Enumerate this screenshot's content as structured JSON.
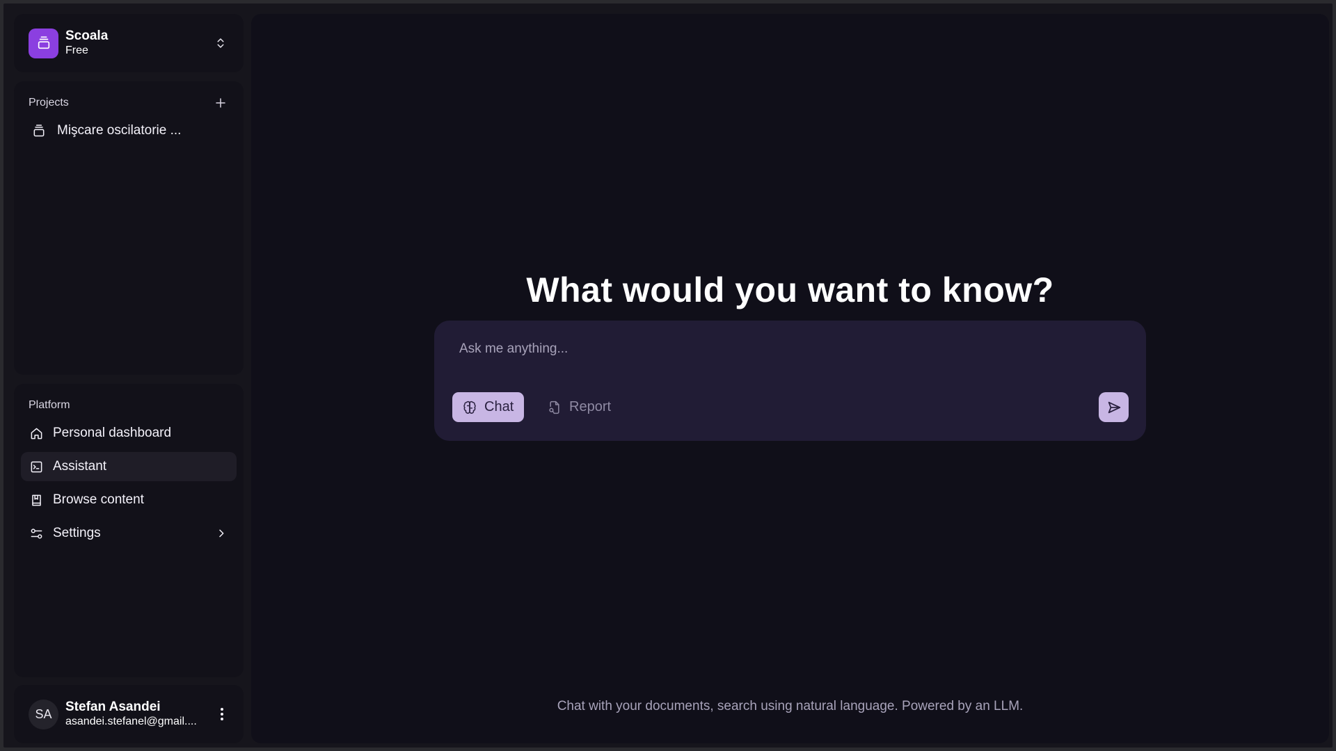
{
  "workspace": {
    "name": "Scoala",
    "plan": "Free",
    "logo_icon": "stack-icon"
  },
  "projects": {
    "title": "Projects",
    "items": [
      {
        "label": "Mişcare oscilatorie ...",
        "icon": "stack-icon"
      }
    ]
  },
  "platform": {
    "title": "Platform",
    "items": [
      {
        "label": "Personal dashboard",
        "icon": "home-icon"
      },
      {
        "label": "Assistant",
        "icon": "terminal-icon",
        "active": true
      },
      {
        "label": "Browse content",
        "icon": "book-icon"
      },
      {
        "label": "Settings",
        "icon": "sliders-icon"
      }
    ]
  },
  "user": {
    "initials": "SA",
    "name": "Stefan Asandei",
    "email": "asandei.stefanel@gmail...."
  },
  "main": {
    "headline": "What would you want to know?",
    "input_placeholder": "Ask me anything...",
    "modes": {
      "chat": "Chat",
      "report": "Report"
    },
    "footer": "Chat with your documents, search using natural language. Powered by an LLM."
  },
  "colors": {
    "accent": "#8b3fe0",
    "chip": "#c8b6e4",
    "composer_bg": "#211c35",
    "main_bg": "#100f19"
  }
}
